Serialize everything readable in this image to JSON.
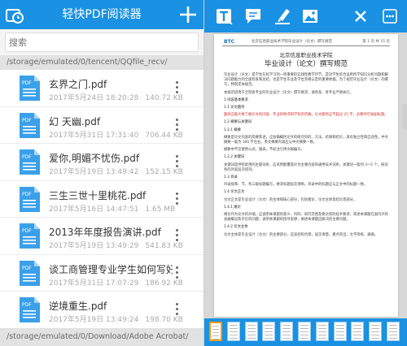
{
  "file_manager": {
    "title": "轻快PDF阅读器",
    "history_icon": "history-icon",
    "add_icon": "plus-icon",
    "search_placeholder": "搜索",
    "current_path": "/storage/emulated/0/tencent/QQfile_recv/",
    "files": [
      {
        "name": "玄界之门.pdf",
        "date": "2017年5月24日 18:20:28",
        "size": "140.72 KB"
      },
      {
        "name": "幻 天幽.pdf",
        "date": "2017年5月31日 17:31:40",
        "size": "706.44 KB"
      },
      {
        "name": "爱你,明媚不忧伤.pdf",
        "date": "2017年5月19日 13:49:42",
        "size": "152.15 KB"
      },
      {
        "name": "三生三世十里桃花.pdf",
        "date": "2017年5月16日 14:47:51",
        "size": "1.65 MB"
      },
      {
        "name": "2013年年度报告演讲.pdf",
        "date": "2017年5月19日 13:49:29",
        "size": "541.83 KB"
      },
      {
        "name": "谈工商管理专业学生如何写好...",
        "date": "2017年5月31日 17:07:29",
        "size": "186.92 KB"
      },
      {
        "name": "逆境重生.pdf",
        "date": "2017年5月19日 13:49:24",
        "size": "198.70 KB"
      }
    ],
    "bottom_path": "/storage/emulated/0/Download/Adobe Acrobat/"
  },
  "reader": {
    "toolbar_icons": [
      "text-tool-icon",
      "comment-icon",
      "highlighter-icon",
      "image-icon",
      "close-icon",
      "more-icon"
    ],
    "page": {
      "logo": "BTC",
      "header_text": "北京信息职业技术学院毕业设计（论文）撰写规范",
      "page_number": "第 1 页 共 15 页",
      "school": "北京信息职业技术学院",
      "title": "毕业设计（论文）撰写规范",
      "paragraphs": [
        {
          "text": "毕业设计（论文）是学生在校学习的一项重要的实践性教学环节，是对学生综合运用所学知识分析问题和解决问题能力的全面检查和总结，也是学生毕业及学位资格认定的重要依据。为了规范毕业设计（论文）的撰写，特制定本规范。",
          "style": "normal"
        },
        {
          "text": "本规范适用于全院各专业的毕业设计（论文）撰写要求，请各系、各专业严格执行。",
          "style": "normal"
        },
        {
          "text": "1  内容基本要求",
          "style": "head"
        },
        {
          "text": "1.1  论文题目",
          "style": "head"
        },
        {
          "text": "题目应能大致了解论文的内容、专业的特点和学科的范畴。论文题目应不超过 25 字，必要时可加副标题。",
          "style": "red"
        },
        {
          "text": "1.2  摘要与关键词",
          "style": "head"
        },
        {
          "text": "1.2.1  摘要",
          "style": "head"
        },
        {
          "text": "摘要是论文内容的简要陈述，应准确概括论文的研究目的、方法、结果和结论，具有独立性和自含性。中文摘要一般为 300 字左右，英文摘要内容应与中文摘要一致。",
          "style": "normal"
        },
        {
          "text": "摘要中不宜使用公式、图表，不标注引用文献编号。",
          "style": "normal"
        },
        {
          "text": "1.2.2  关键词",
          "style": "head"
        },
        {
          "text": "关键词是供检索用的主题词条，应采用能覆盖论文主要内容的通用技术词条。关键词一般列 3～5 个，按词条的外延层次排列。",
          "style": "normal"
        },
        {
          "text": "1.3  目录",
          "style": "head"
        },
        {
          "text": "目录按章、节、条三级标题编写，要求标题层次清晰。目录中的标题应与正文中的标题一致。",
          "style": "normal"
        },
        {
          "text": "1.4  论文正文",
          "style": "head"
        },
        {
          "text": "论文正文是毕业设计（论文）的主体和核心部分，包括绪论、论文主体及结论等部分。",
          "style": "normal"
        },
        {
          "text": "1.4.1  绪论",
          "style": "head"
        },
        {
          "text": "绪论作为论文的开端，应说明本课题的意义、目的、研究范围及要达到的技术要求；简述本课题在国内外的发展概况及存在的问题；说明本课题的指导思想；阐述本课题应解决的主要问题。",
          "style": "normal"
        },
        {
          "text": "1.4.2  论文主体",
          "style": "head"
        },
        {
          "text": "论文主体是毕业设计（论文）的主要部分，应该结构合理，层次清楚，重点突出，文字简练、通顺。",
          "style": "normal"
        }
      ]
    },
    "thumbnails_count": 11,
    "selected_thumbnail": 1
  }
}
